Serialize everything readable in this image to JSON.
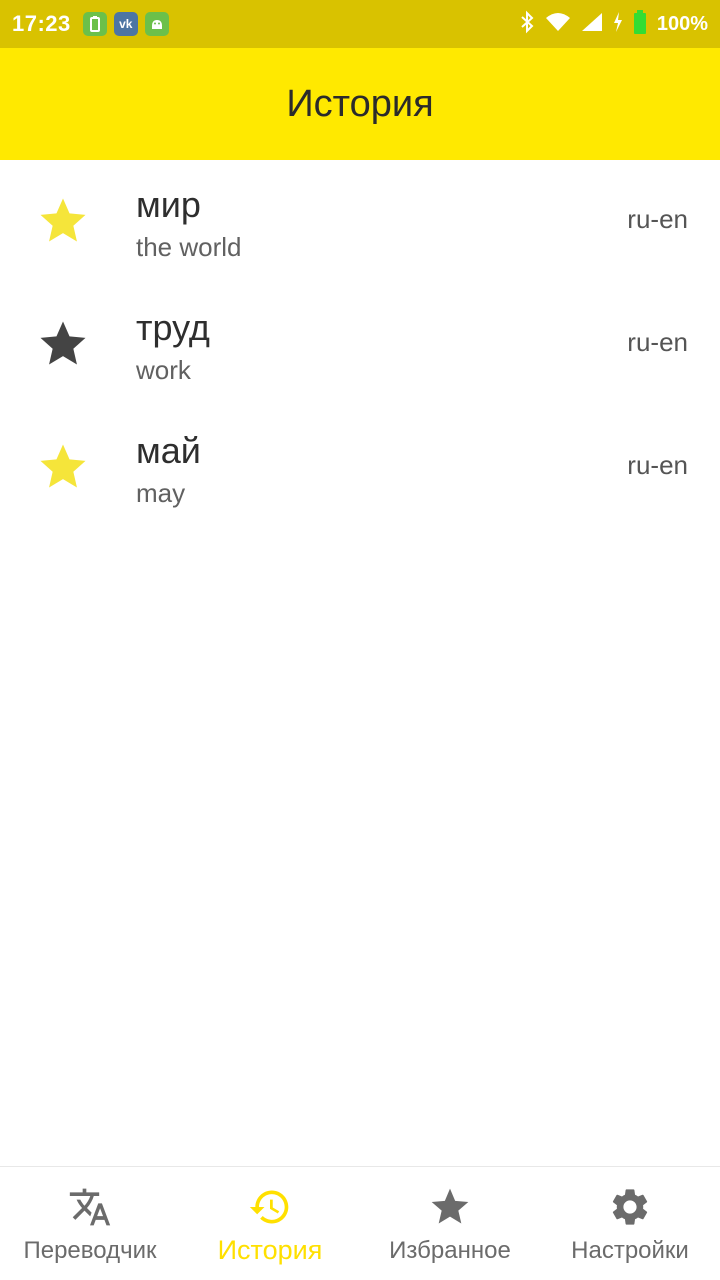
{
  "status_bar": {
    "time": "17:23",
    "battery": "100%",
    "notification_icons": [
      "battery-app-icon",
      "vk-icon",
      "android-icon"
    ],
    "vk_label": "vk"
  },
  "app_bar": {
    "title": "История"
  },
  "history": {
    "items": [
      {
        "word": "мир",
        "translation": "the world",
        "lang": "ru-en",
        "favorite": true
      },
      {
        "word": "труд",
        "translation": "work",
        "lang": "ru-en",
        "favorite": false
      },
      {
        "word": "май",
        "translation": "may",
        "lang": "ru-en",
        "favorite": true
      }
    ]
  },
  "bottom_nav": {
    "items": [
      {
        "label": "Переводчик",
        "icon": "translate-icon",
        "active": false
      },
      {
        "label": "История",
        "icon": "history-icon",
        "active": true
      },
      {
        "label": "Избранное",
        "icon": "star-icon",
        "active": false
      },
      {
        "label": "Настройки",
        "icon": "gear-icon",
        "active": false
      }
    ]
  },
  "colors": {
    "status_bar": "#d9c200",
    "app_bar": "#ffe900",
    "star_favorite": "#f5e53a",
    "star_default": "#444444",
    "nav_active": "#ffe000",
    "nav_inactive": "#6b6b6b"
  }
}
